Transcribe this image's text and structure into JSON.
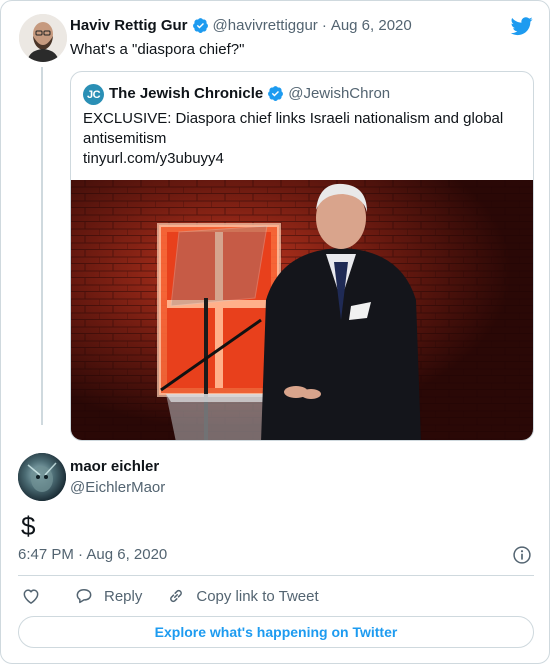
{
  "tweet": {
    "author_name": "Haviv Rettig Gur",
    "author_handle": "@havivrettiggur",
    "separator": "·",
    "date": "Aug 6, 2020",
    "text": "What's a \"diaspora chief?\""
  },
  "quoted_tweet": {
    "logo_text": "JC",
    "author_name": "The Jewish Chronicle",
    "author_handle": "@JewishChron",
    "text": "EXCLUSIVE: Diaspora chief links Israeli nationalism and global antisemitism",
    "link": "tinyurl.com/y3ubuyy4"
  },
  "reply": {
    "author_name": "maor eichler",
    "author_handle": "@EichlerMaor",
    "text": "$",
    "timestamp": "6:47 PM · Aug 6, 2020"
  },
  "actions": {
    "reply_label": "Reply",
    "copy_label": "Copy link to Tweet"
  },
  "explore_label": "Explore what's happening on Twitter",
  "colors": {
    "accent": "#1d9bf0",
    "muted_text": "#536471",
    "border": "#cfd9de",
    "verified": "#1d9bf0"
  },
  "icons": [
    "verified-badge-icon",
    "twitter-bird-icon",
    "info-icon",
    "heart-icon",
    "reply-icon",
    "link-icon"
  ]
}
